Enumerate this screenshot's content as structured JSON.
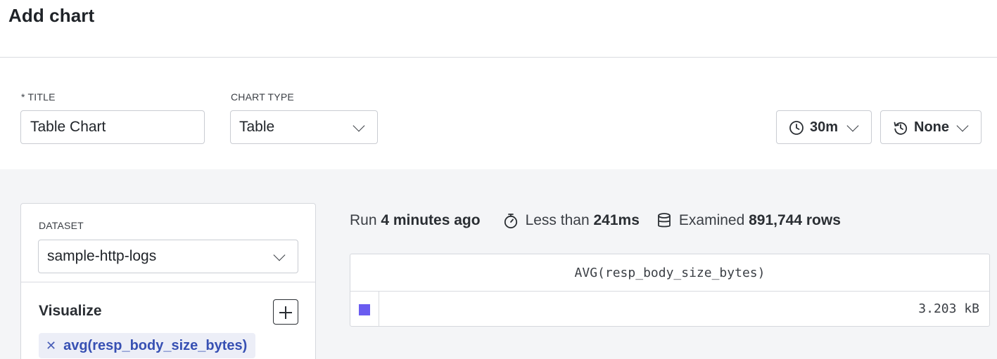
{
  "header": {
    "title": "Add chart"
  },
  "form": {
    "title_label": "* TITLE",
    "title_value": "Table Chart",
    "chart_type_label": "CHART TYPE",
    "chart_type_value": "Table",
    "time_range": "30m",
    "compare": "None"
  },
  "query": {
    "dataset_label": "DATASET",
    "dataset_value": "sample-http-logs",
    "visualize_label": "Visualize",
    "visualize_items": [
      {
        "label": "avg(resp_body_size_bytes)"
      }
    ]
  },
  "stats": {
    "run_prefix": "Run",
    "run_value": "4 minutes ago",
    "duration_prefix": "Less than",
    "duration_value": "241ms",
    "examined_prefix": "Examined",
    "examined_value": "891,744 rows"
  },
  "table": {
    "column_header": "AVG(resp_body_size_bytes)",
    "rows": [
      {
        "value": "3.203 kB",
        "color": "#6a5cf0"
      }
    ]
  },
  "colors": {
    "accent": "#3750b3",
    "series": "#6a5cf0"
  }
}
